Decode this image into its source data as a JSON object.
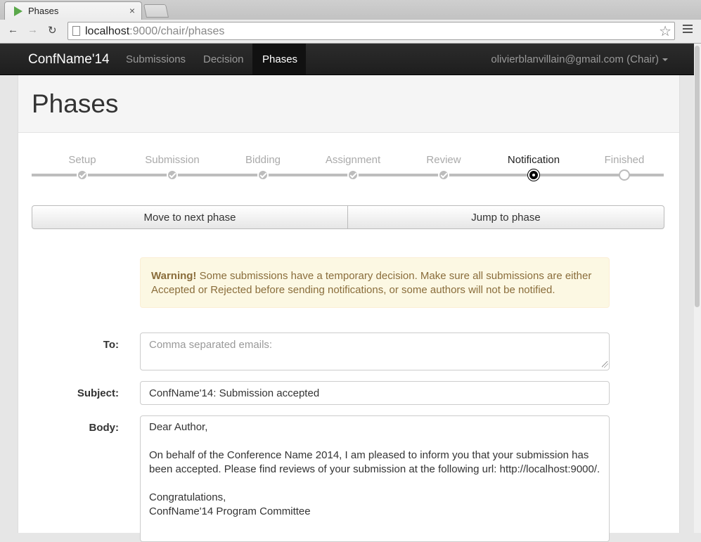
{
  "browser": {
    "tab_title": "Phases",
    "tab_close": "×",
    "url_host": "localhost",
    "url_rest": ":9000/chair/phases"
  },
  "navbar": {
    "brand": "ConfName'14",
    "links": [
      "Submissions",
      "Decision",
      "Phases"
    ],
    "user": "olivierblanvillain@gmail.com (Chair)"
  },
  "page": {
    "title": "Phases"
  },
  "phases": {
    "items": [
      {
        "label": "Setup",
        "state": "done"
      },
      {
        "label": "Submission",
        "state": "done"
      },
      {
        "label": "Bidding",
        "state": "done"
      },
      {
        "label": "Assignment",
        "state": "done"
      },
      {
        "label": "Review",
        "state": "done"
      },
      {
        "label": "Notification",
        "state": "current"
      },
      {
        "label": "Finished",
        "state": "todo"
      }
    ],
    "next_button": "Move to next phase",
    "jump_button": "Jump to phase"
  },
  "warning": {
    "strong": "Warning!",
    "text": " Some submissions have a temporary decision. Make sure all submissions are either Accepted or Rejected before sending notifications, or some authors will not be notified."
  },
  "form": {
    "to_label": "To:",
    "to_placeholder": "Comma separated emails:",
    "to_value": "",
    "subject_label": "Subject:",
    "subject_value": "ConfName'14: Submission accepted",
    "body_label": "Body:",
    "body_value": "Dear Author,\n\nOn behalf of the Conference Name 2014, I am pleased to inform you that your submission has been accepted. Please find reviews of your submission at the following url: http://localhost:9000/.\n\nCongratulations,\nConfName'14 Program Committee"
  },
  "colors": {
    "navbar": "#222222",
    "warning_bg": "#fcf8e3",
    "warning_text": "#8a6d3b"
  }
}
